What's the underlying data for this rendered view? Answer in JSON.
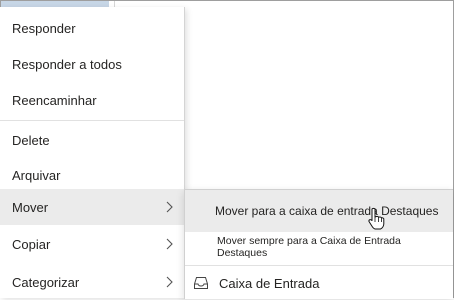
{
  "context_menu": {
    "items": [
      {
        "label": "Responder"
      },
      {
        "label": "Responder a todos"
      },
      {
        "label": "Reencaminhar"
      },
      {
        "label": "Delete"
      },
      {
        "label": "Arquivar"
      },
      {
        "label": "Mover",
        "state": "hovered",
        "has_submenu": true
      },
      {
        "label": "Copiar",
        "has_submenu": true
      },
      {
        "label": "Categorizar",
        "has_submenu": true
      }
    ]
  },
  "submenu": {
    "items": [
      {
        "label": "Mover para a caixa de entrada Destaques",
        "state": "hovered"
      },
      {
        "label": "Mover sempre para a Caixa de Entrada Destaques"
      },
      {
        "label": "Caixa de Entrada",
        "icon": "inbox-tray-icon"
      }
    ]
  },
  "icons": {
    "chevron": "chevron-right-icon",
    "cursor": "hand-pointer-cursor-icon"
  },
  "colors": {
    "hover_background": "#ebebeb",
    "text": "#252423",
    "selected_background": "#c7d6e6"
  }
}
